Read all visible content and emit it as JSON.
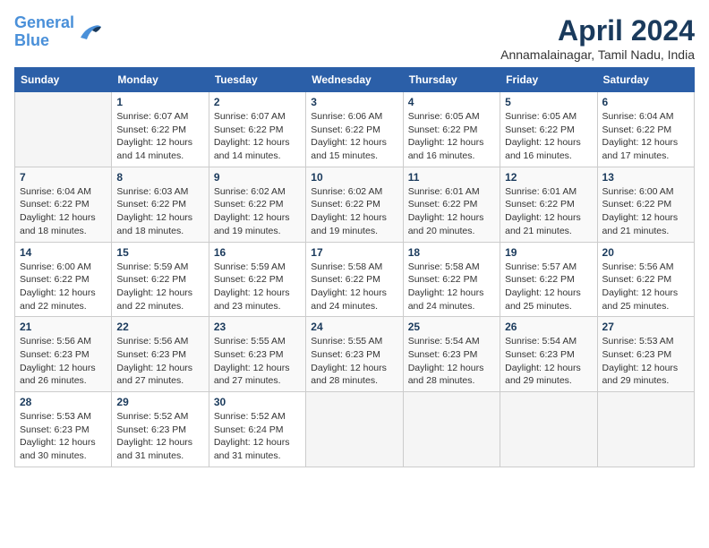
{
  "header": {
    "logo_line1": "General",
    "logo_line2": "Blue",
    "month": "April 2024",
    "location": "Annamalainagar, Tamil Nadu, India"
  },
  "weekdays": [
    "Sunday",
    "Monday",
    "Tuesday",
    "Wednesday",
    "Thursday",
    "Friday",
    "Saturday"
  ],
  "weeks": [
    [
      {
        "day": "",
        "info": ""
      },
      {
        "day": "1",
        "info": "Sunrise: 6:07 AM\nSunset: 6:22 PM\nDaylight: 12 hours\nand 14 minutes."
      },
      {
        "day": "2",
        "info": "Sunrise: 6:07 AM\nSunset: 6:22 PM\nDaylight: 12 hours\nand 14 minutes."
      },
      {
        "day": "3",
        "info": "Sunrise: 6:06 AM\nSunset: 6:22 PM\nDaylight: 12 hours\nand 15 minutes."
      },
      {
        "day": "4",
        "info": "Sunrise: 6:05 AM\nSunset: 6:22 PM\nDaylight: 12 hours\nand 16 minutes."
      },
      {
        "day": "5",
        "info": "Sunrise: 6:05 AM\nSunset: 6:22 PM\nDaylight: 12 hours\nand 16 minutes."
      },
      {
        "day": "6",
        "info": "Sunrise: 6:04 AM\nSunset: 6:22 PM\nDaylight: 12 hours\nand 17 minutes."
      }
    ],
    [
      {
        "day": "7",
        "info": "Sunrise: 6:04 AM\nSunset: 6:22 PM\nDaylight: 12 hours\nand 18 minutes."
      },
      {
        "day": "8",
        "info": "Sunrise: 6:03 AM\nSunset: 6:22 PM\nDaylight: 12 hours\nand 18 minutes."
      },
      {
        "day": "9",
        "info": "Sunrise: 6:02 AM\nSunset: 6:22 PM\nDaylight: 12 hours\nand 19 minutes."
      },
      {
        "day": "10",
        "info": "Sunrise: 6:02 AM\nSunset: 6:22 PM\nDaylight: 12 hours\nand 19 minutes."
      },
      {
        "day": "11",
        "info": "Sunrise: 6:01 AM\nSunset: 6:22 PM\nDaylight: 12 hours\nand 20 minutes."
      },
      {
        "day": "12",
        "info": "Sunrise: 6:01 AM\nSunset: 6:22 PM\nDaylight: 12 hours\nand 21 minutes."
      },
      {
        "day": "13",
        "info": "Sunrise: 6:00 AM\nSunset: 6:22 PM\nDaylight: 12 hours\nand 21 minutes."
      }
    ],
    [
      {
        "day": "14",
        "info": "Sunrise: 6:00 AM\nSunset: 6:22 PM\nDaylight: 12 hours\nand 22 minutes."
      },
      {
        "day": "15",
        "info": "Sunrise: 5:59 AM\nSunset: 6:22 PM\nDaylight: 12 hours\nand 22 minutes."
      },
      {
        "day": "16",
        "info": "Sunrise: 5:59 AM\nSunset: 6:22 PM\nDaylight: 12 hours\nand 23 minutes."
      },
      {
        "day": "17",
        "info": "Sunrise: 5:58 AM\nSunset: 6:22 PM\nDaylight: 12 hours\nand 24 minutes."
      },
      {
        "day": "18",
        "info": "Sunrise: 5:58 AM\nSunset: 6:22 PM\nDaylight: 12 hours\nand 24 minutes."
      },
      {
        "day": "19",
        "info": "Sunrise: 5:57 AM\nSunset: 6:22 PM\nDaylight: 12 hours\nand 25 minutes."
      },
      {
        "day": "20",
        "info": "Sunrise: 5:56 AM\nSunset: 6:22 PM\nDaylight: 12 hours\nand 25 minutes."
      }
    ],
    [
      {
        "day": "21",
        "info": "Sunrise: 5:56 AM\nSunset: 6:23 PM\nDaylight: 12 hours\nand 26 minutes."
      },
      {
        "day": "22",
        "info": "Sunrise: 5:56 AM\nSunset: 6:23 PM\nDaylight: 12 hours\nand 27 minutes."
      },
      {
        "day": "23",
        "info": "Sunrise: 5:55 AM\nSunset: 6:23 PM\nDaylight: 12 hours\nand 27 minutes."
      },
      {
        "day": "24",
        "info": "Sunrise: 5:55 AM\nSunset: 6:23 PM\nDaylight: 12 hours\nand 28 minutes."
      },
      {
        "day": "25",
        "info": "Sunrise: 5:54 AM\nSunset: 6:23 PM\nDaylight: 12 hours\nand 28 minutes."
      },
      {
        "day": "26",
        "info": "Sunrise: 5:54 AM\nSunset: 6:23 PM\nDaylight: 12 hours\nand 29 minutes."
      },
      {
        "day": "27",
        "info": "Sunrise: 5:53 AM\nSunset: 6:23 PM\nDaylight: 12 hours\nand 29 minutes."
      }
    ],
    [
      {
        "day": "28",
        "info": "Sunrise: 5:53 AM\nSunset: 6:23 PM\nDaylight: 12 hours\nand 30 minutes."
      },
      {
        "day": "29",
        "info": "Sunrise: 5:52 AM\nSunset: 6:23 PM\nDaylight: 12 hours\nand 31 minutes."
      },
      {
        "day": "30",
        "info": "Sunrise: 5:52 AM\nSunset: 6:24 PM\nDaylight: 12 hours\nand 31 minutes."
      },
      {
        "day": "",
        "info": ""
      },
      {
        "day": "",
        "info": ""
      },
      {
        "day": "",
        "info": ""
      },
      {
        "day": "",
        "info": ""
      }
    ]
  ]
}
